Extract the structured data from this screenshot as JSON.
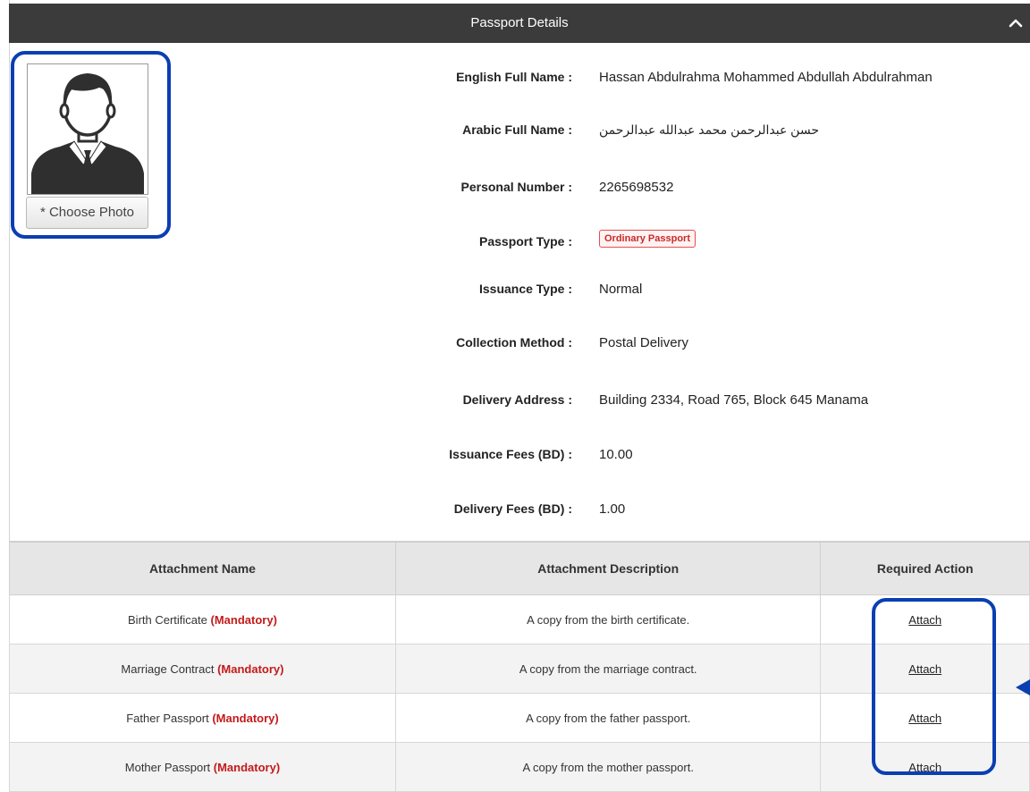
{
  "header": {
    "title": "Passport Details"
  },
  "photo": {
    "choose_label": "* Choose Photo"
  },
  "fields": [
    {
      "label": "English Full Name :",
      "value": "Hassan Abdulrahma Mohammed Abdullah Abdulrahman"
    },
    {
      "label": "Arabic Full Name :",
      "value": "حسن عبدالرحمن محمد عبدالله عبدالرحمن"
    },
    {
      "label": "Personal Number :",
      "value": "2265698532"
    },
    {
      "label": "Passport Type :",
      "value": "Ordinary Passport"
    },
    {
      "label": "Issuance Type :",
      "value": "Normal"
    },
    {
      "label": "Collection Method :",
      "value": "Postal Delivery"
    },
    {
      "label": "Delivery Address :",
      "value": "Building 2334, Road 765, Block 645 Manama"
    },
    {
      "label": "Issuance Fees (BD) :",
      "value": "10.00"
    },
    {
      "label": "Delivery Fees (BD) :",
      "value": "1.00"
    }
  ],
  "attachments": {
    "headers": [
      "Attachment Name",
      "Attachment Description",
      "Required Action"
    ],
    "mandatory_label": "(Mandatory)",
    "rows": [
      {
        "name": "Birth Certificate",
        "description": "A copy from the birth certificate.",
        "action": "Attach"
      },
      {
        "name": "Marriage Contract",
        "description": "A copy from the marriage contract.",
        "action": "Attach"
      },
      {
        "name": "Father Passport",
        "description": "A copy from the father passport.",
        "action": "Attach"
      },
      {
        "name": "Mother Passport",
        "description": "A copy from the mother passport.",
        "action": "Attach"
      }
    ]
  },
  "colors": {
    "header_bg": "#3b3b3b",
    "highlight": "#0a3fb2",
    "mandatory": "#c41a1a",
    "badge": "#c72a2a"
  },
  "icons": {
    "collapse": "chevron-up-icon",
    "avatar": "person-avatar-icon"
  }
}
